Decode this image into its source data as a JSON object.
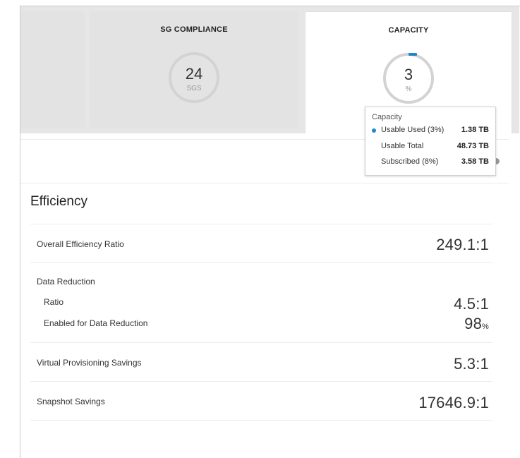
{
  "tiles": [
    {
      "title": "SG COMPLIANCE",
      "value": "24",
      "unit": "SGS"
    },
    {
      "title": "CAPACITY",
      "value": "3",
      "unit": "%"
    }
  ],
  "tooltip": {
    "title": "Capacity",
    "rows": [
      {
        "label": "Usable Used (3%)",
        "value": "1.38 TB"
      },
      {
        "label": "Usable Total",
        "value": "48.73 TB"
      },
      {
        "label": "Subscribed (8%)",
        "value": "3.58 TB"
      }
    ]
  },
  "efficiency": {
    "title": "Efficiency",
    "overall": {
      "label": "Overall Efficiency Ratio",
      "value": "249.1:1"
    },
    "data_reduction": {
      "label": "Data Reduction",
      "ratio_label": "Ratio",
      "ratio_value": "4.5:1",
      "enabled_label": "Enabled for Data Reduction",
      "enabled_value": "98",
      "enabled_unit": "%"
    },
    "virtual": {
      "label": "Virtual Provisioning Savings",
      "value": "5.3:1"
    },
    "snapshot": {
      "label": "Snapshot Savings",
      "value": "17646.9:1"
    }
  },
  "colors": {
    "accent": "#1e88c9",
    "ring": "#d3d3d3",
    "tile_bg": "#e3e3e3"
  }
}
